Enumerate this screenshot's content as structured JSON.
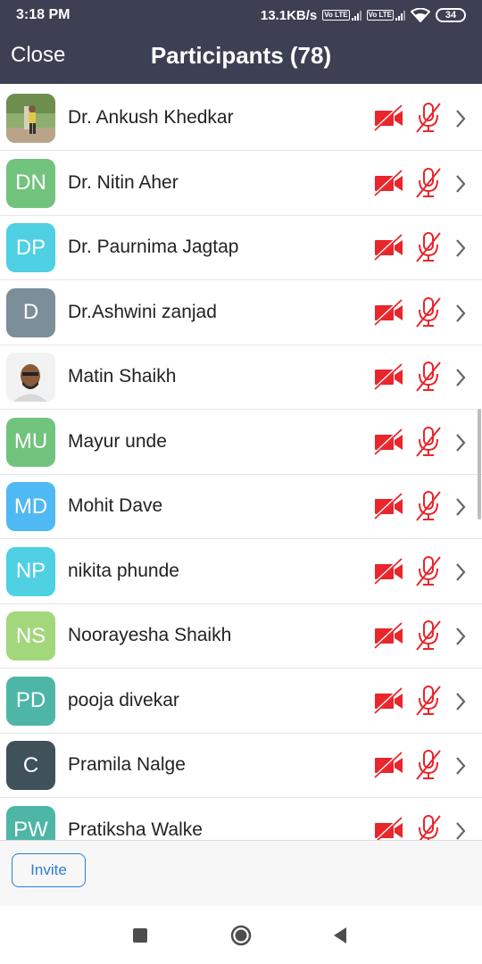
{
  "status_bar": {
    "time": "3:18 PM",
    "net_speed": "13.1KB/s",
    "volte1": "Vo LTE",
    "volte2": "Vo LTE",
    "battery": "34",
    "icons": [
      "signal-icon",
      "wifi-icon",
      "battery-icon"
    ]
  },
  "header": {
    "close_label": "Close",
    "title": "Participants (78)"
  },
  "participants": [
    {
      "name": "Dr. Ankush Khedkar",
      "initials": "",
      "avatar_type": "photo-outdoor",
      "color": "#7a9a5a"
    },
    {
      "name": "Dr. Nitin Aher",
      "initials": "DN",
      "avatar_type": "initials",
      "color": "#72c37e"
    },
    {
      "name": "Dr. Paurnima Jagtap",
      "initials": "DP",
      "avatar_type": "initials",
      "color": "#4fd0e3"
    },
    {
      "name": "Dr.Ashwini zanjad",
      "initials": "D",
      "avatar_type": "initials",
      "color": "#7b8e99"
    },
    {
      "name": "Matin Shaikh",
      "initials": "",
      "avatar_type": "photo-portrait",
      "color": "#e8e8e8"
    },
    {
      "name": "Mayur unde",
      "initials": "MU",
      "avatar_type": "initials",
      "color": "#72c37e"
    },
    {
      "name": "Mohit Dave",
      "initials": "MD",
      "avatar_type": "initials",
      "color": "#4fb9f3"
    },
    {
      "name": "nikita phunde",
      "initials": "NP",
      "avatar_type": "initials",
      "color": "#4fd0e3"
    },
    {
      "name": "Noorayesha Shaikh",
      "initials": "NS",
      "avatar_type": "initials",
      "color": "#a3d77c"
    },
    {
      "name": "pooja divekar",
      "initials": "PD",
      "avatar_type": "initials",
      "color": "#4db6a6"
    },
    {
      "name": "Pramila Nalge",
      "initials": "C",
      "avatar_type": "initials",
      "color": "#3f5159"
    },
    {
      "name": "Pratiksha Walke",
      "initials": "PW",
      "avatar_type": "initials",
      "color": "#4db6a6"
    }
  ],
  "row_icons": {
    "video": "video-off-icon",
    "mic": "mic-muted-icon",
    "chevron": "chevron-right-icon",
    "muted_color": "#e8262c"
  },
  "footer": {
    "invite_label": "Invite",
    "accent": "#2d7fd0"
  },
  "navbar": {
    "icons": [
      "recents-icon",
      "home-icon",
      "back-icon"
    ]
  }
}
